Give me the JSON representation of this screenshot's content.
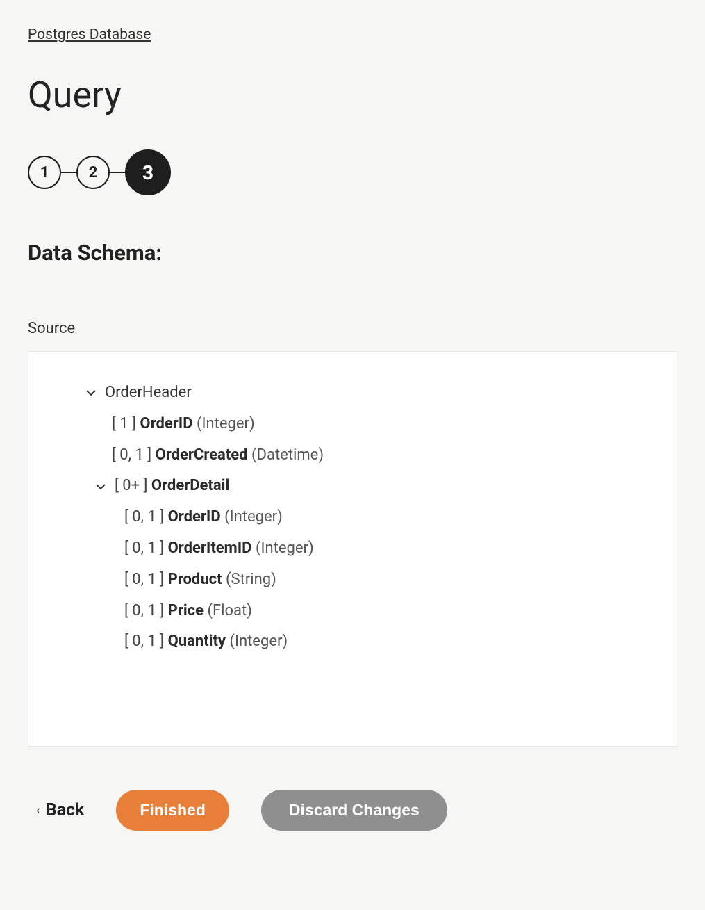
{
  "breadcrumb": "Postgres Database",
  "page_title": "Query",
  "steps": [
    "1",
    "2",
    "3"
  ],
  "active_step_index": 2,
  "section_heading": "Data Schema:",
  "source_label": "Source",
  "schema": {
    "root_name": "OrderHeader",
    "fields": [
      {
        "cardinality": "[ 1 ]",
        "name": "OrderID",
        "type": "(Integer)"
      },
      {
        "cardinality": "[ 0, 1 ]",
        "name": "OrderCreated",
        "type": "(Datetime)"
      }
    ],
    "child": {
      "cardinality": "[ 0+ ]",
      "name": "OrderDetail",
      "fields": [
        {
          "cardinality": "[ 0, 1 ]",
          "name": "OrderID",
          "type": "(Integer)"
        },
        {
          "cardinality": "[ 0, 1 ]",
          "name": "OrderItemID",
          "type": "(Integer)"
        },
        {
          "cardinality": "[ 0, 1 ]",
          "name": "Product",
          "type": "(String)"
        },
        {
          "cardinality": "[ 0, 1 ]",
          "name": "Price",
          "type": "(Float)"
        },
        {
          "cardinality": "[ 0, 1 ]",
          "name": "Quantity",
          "type": "(Integer)"
        }
      ]
    }
  },
  "buttons": {
    "back": "Back",
    "finished": "Finished",
    "discard": "Discard Changes"
  }
}
